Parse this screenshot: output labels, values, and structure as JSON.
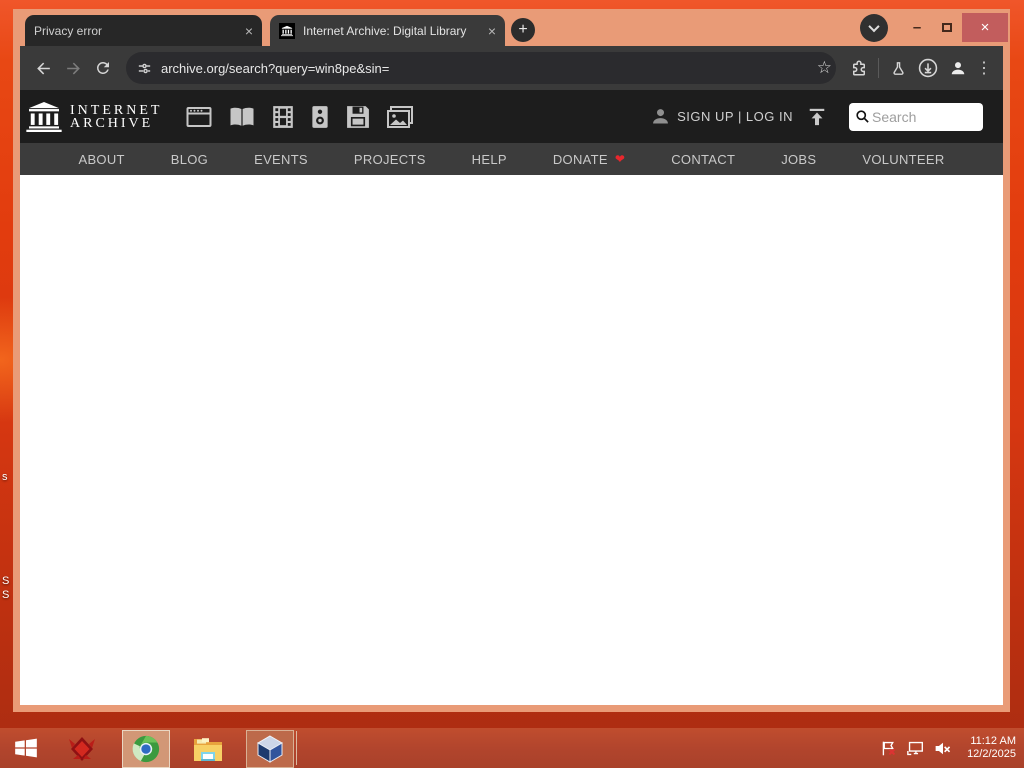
{
  "colors": {
    "frame_salmon": "#e99b77",
    "desktop_red": "#e23c0e",
    "taskbar_red": "#b2452d",
    "toolbar_gray": "#3a3a3a",
    "ia_header_dark": "#1d1d1d",
    "ia_nav_gray": "#3c3c3c",
    "heart_red": "#e8272d",
    "close_button_red": "#c25d5d"
  },
  "browser": {
    "tabs": [
      {
        "title": "Privacy error",
        "close": "×",
        "active": false
      },
      {
        "title": "Internet Archive: Digital Library",
        "close": "×",
        "active": true
      }
    ],
    "new_tab_label": "+",
    "url": "archive.org/search?query=win8pe&sin=",
    "window_controls": {
      "minimize": "–",
      "close": "×"
    },
    "menu_kebab": "⋮",
    "bookmark_star": "☆"
  },
  "ia": {
    "wordmark": {
      "line1": "INTERNET",
      "line2": "ARCHIVE"
    },
    "auth": "SIGN UP | LOG IN",
    "search_placeholder": "Search",
    "donate_heart": "❤",
    "nav": [
      "ABOUT",
      "BLOG",
      "EVENTS",
      "PROJECTS",
      "HELP",
      "DONATE",
      "CONTACT",
      "JOBS",
      "VOLUNTEER"
    ]
  },
  "desktop": {
    "fragments": [
      "s",
      "S",
      "S"
    ]
  },
  "taskbar": {
    "clock": {
      "time": "11:12 AM",
      "date": "12/2/2025"
    }
  }
}
